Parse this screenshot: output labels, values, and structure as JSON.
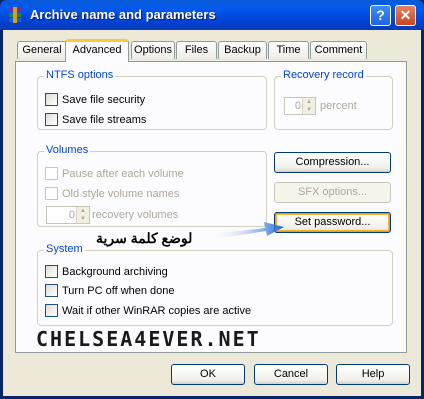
{
  "window": {
    "title": "Archive name and parameters",
    "help_symbol": "?",
    "close_symbol": "✕"
  },
  "tabs": [
    {
      "label": "General"
    },
    {
      "label": "Advanced",
      "active": true
    },
    {
      "label": "Options"
    },
    {
      "label": "Files"
    },
    {
      "label": "Backup"
    },
    {
      "label": "Time"
    },
    {
      "label": "Comment"
    }
  ],
  "ntfs": {
    "title": "NTFS options",
    "save_security": "Save file security",
    "save_streams": "Save file streams"
  },
  "recovery": {
    "title": "Recovery record",
    "value": "0",
    "unit": "percent"
  },
  "volumes": {
    "title": "Volumes",
    "pause": "Pause after each volume",
    "old_names": "Old style volume names",
    "recovery_value": "0",
    "recovery_label": "recovery volumes"
  },
  "buttons": {
    "compression": "Compression...",
    "sfx": "SFX options...",
    "set_password": "Set password...",
    "ok": "OK",
    "cancel": "Cancel",
    "help": "Help"
  },
  "system": {
    "title": "System",
    "background": "Background archiving",
    "turn_off": "Turn PC off when done",
    "wait": "Wait if other WinRAR copies are active"
  },
  "annotation": {
    "text": "لوضع كلمة سرية",
    "color": "#1e62d0"
  },
  "watermark": "CHELSEA4EVER.NET",
  "colors": {
    "titlebar": "#0058ee",
    "group_label": "#0046d5",
    "tab_highlight": "#ffc83c"
  }
}
